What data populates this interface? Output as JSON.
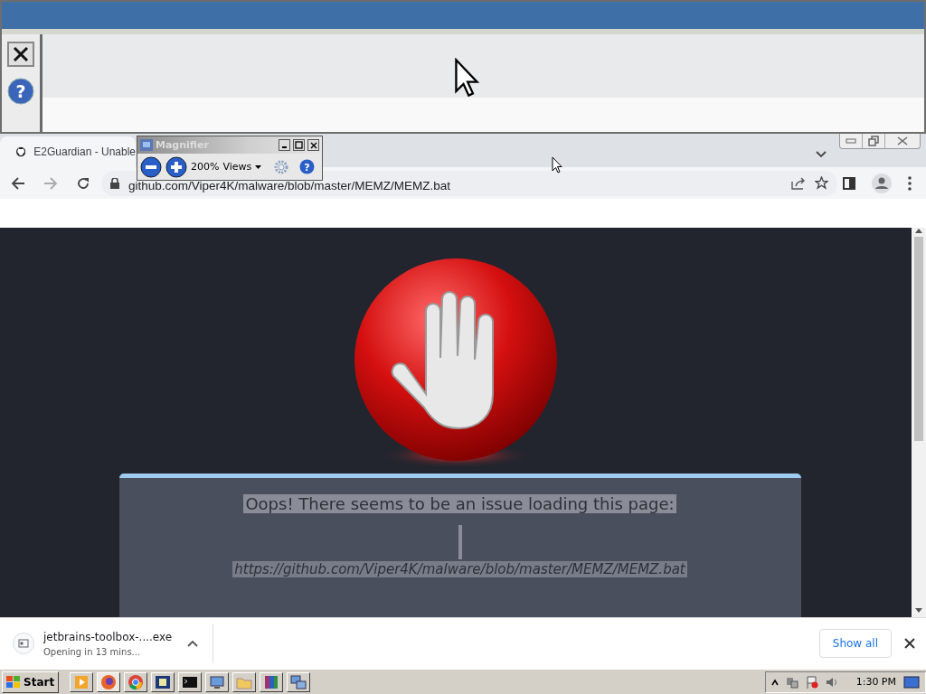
{
  "magnified_view": {
    "help_glyph": "?"
  },
  "browser": {
    "tab": {
      "title": "E2Guardian - Unable",
      "selected": true
    },
    "address": "github.com/Viper4K/malware/blob/master/MEMZ/MEMZ.bat"
  },
  "magnifier": {
    "title": "Magnifier",
    "zoom": "200%",
    "views": "Views",
    "help_glyph": "?"
  },
  "page": {
    "message": "Oops! There seems to be an issue loading this page:",
    "url": "https://github.com/Viper4K/malware/blob/master/MEMZ/MEMZ.bat"
  },
  "download": {
    "file": "jetbrains-toolbox-....exe",
    "status": "Opening in 13 mins...",
    "button": "Show all"
  },
  "taskbar": {
    "start": "Start",
    "time": "1:30 PM"
  }
}
